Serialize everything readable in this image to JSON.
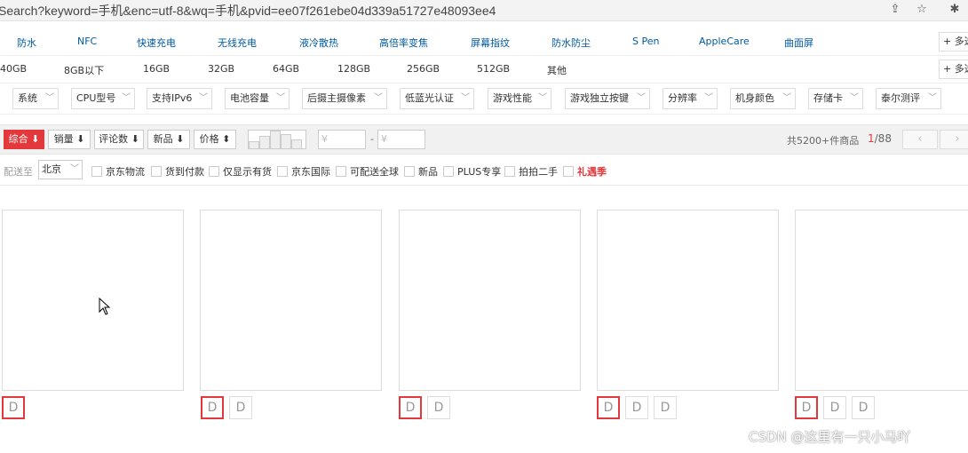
{
  "browser": {
    "url": "Search?keyword=手机&enc=utf-8&wq=手机&pvid=ee07f261ebe04d339a51727e48093ee4",
    "icons": [
      "share-icon",
      "star-icon",
      "extension-icon"
    ]
  },
  "features_row": {
    "items": [
      "防水",
      "NFC",
      "快速充电",
      "无线充电",
      "液冷散热",
      "高倍率变焦",
      "屏幕指纹",
      "防水防尘",
      "S Pen",
      "AppleCare",
      "曲面屏"
    ],
    "more_label": "+ 多选"
  },
  "storage_row": {
    "items": [
      "40GB",
      "8GB以下",
      "16GB",
      "32GB",
      "64GB",
      "128GB",
      "256GB",
      "512GB",
      "其他"
    ],
    "more_label": "+ 多选"
  },
  "dropdown_filters": [
    "系统",
    "CPU型号",
    "支持IPv6",
    "电池容量",
    "后摄主摄像素",
    "低蓝光认证",
    "游戏性能",
    "游戏独立按键",
    "分辨率",
    "机身颜色",
    "存储卡",
    "泰尔测评"
  ],
  "sort_bar": {
    "buttons": [
      "综合 ⬇",
      "销量 ⬇",
      "评论数 ⬇",
      "新品 ⬇",
      "价格 ⬍"
    ],
    "price_min_placeholder": "¥",
    "price_max_placeholder": "¥",
    "dash": "-",
    "total": "共5200+件商品",
    "page_current": "1",
    "page_total": "/88",
    "prev": "‹",
    "next": "›"
  },
  "ship_row": {
    "label": "配送至",
    "location": "北京",
    "options": [
      "京东物流",
      "货到付款",
      "仅显示有货",
      "京东国际",
      "可配送全球",
      "新品",
      "PLUS专享",
      "拍拍二手",
      "礼遇季"
    ]
  },
  "products": [
    {
      "thumbs": 1
    },
    {
      "thumbs": 2
    },
    {
      "thumbs": 2
    },
    {
      "thumbs": 3
    },
    {
      "thumbs": 3
    }
  ],
  "watermark": "CSDN @这里有一只小马吖",
  "colors": {
    "accent": "#e4393c",
    "link": "#005aa0"
  }
}
